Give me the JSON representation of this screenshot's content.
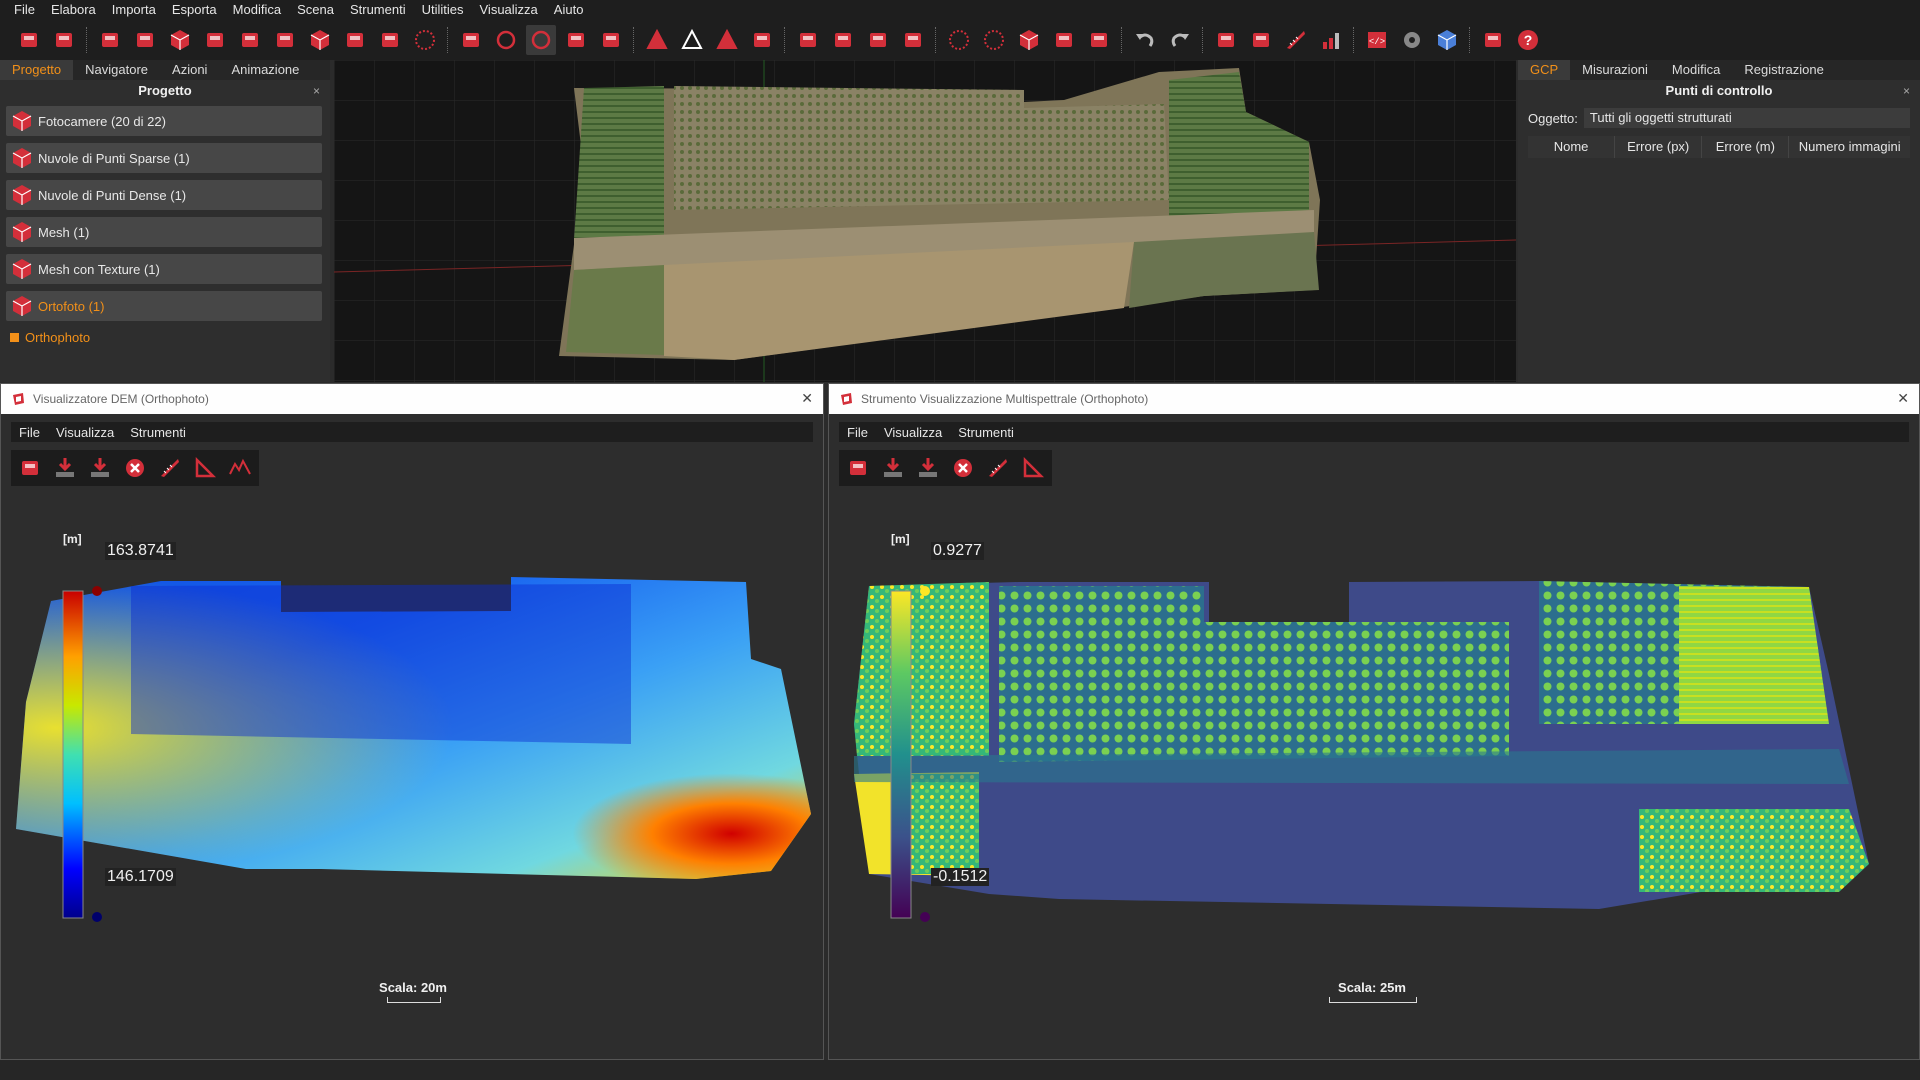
{
  "menu": [
    "File",
    "Elabora",
    "Importa",
    "Esporta",
    "Modifica",
    "Scena",
    "Strumenti",
    "Utilities",
    "Visualizza",
    "Aiuto"
  ],
  "toolbar_icons": [
    "open-folder-icon",
    "save-icon",
    "new-project-icon",
    "add-cameras-icon",
    "cube-icon",
    "import-icon",
    "sparse-cloud-icon",
    "dense-cloud-icon",
    "mesh-icon",
    "texture-icon",
    "photo-icon",
    "sphere-icon",
    "camera-icon",
    "rotate-icon",
    "orbit-icon",
    "dots-icon",
    "point-light-icon",
    "mesh-shade-icon",
    "wireframe-icon",
    "solid-icon",
    "brush-icon",
    "projector-icon",
    "hand-icon",
    "cursor-icon",
    "cloud-icon",
    "sphere-grid-icon",
    "sphere-dots-icon",
    "red-cube-icon",
    "box-grid-icon",
    "export-icon",
    "undo-icon",
    "redo-icon",
    "gizmo-icon",
    "crop-icon",
    "ruler-icon",
    "chart-icon",
    "script-icon",
    "settings-icon",
    "cube-blue-icon",
    "logo-icon",
    "help-icon"
  ],
  "colors": {
    "accent": "#f29019",
    "brand_red": "#d32f3a",
    "panel": "#2e2e2e",
    "bg": "#151515"
  },
  "left_panel": {
    "tabs": [
      "Progetto",
      "Navigatore",
      "Azioni",
      "Animazione"
    ],
    "title": "Progetto",
    "items": [
      {
        "label": "Fotocamere (20 di 22)",
        "icon": "cameras-icon"
      },
      {
        "label": "Nuvole di Punti Sparse (1)",
        "icon": "sparse-cloud-icon"
      },
      {
        "label": "Nuvole di Punti Dense (1)",
        "icon": "dense-cloud-icon"
      },
      {
        "label": "Mesh (1)",
        "icon": "mesh-icon"
      },
      {
        "label": "Mesh con Texture (1)",
        "icon": "textured-mesh-icon"
      },
      {
        "label": "Ortofoto (1)",
        "icon": "orthophoto-icon"
      }
    ],
    "subitem": "Orthophoto"
  },
  "right_panel": {
    "tabs": [
      "GCP",
      "Misurazioni",
      "Modifica",
      "Registrazione"
    ],
    "title": "Punti di controllo",
    "object_label": "Oggetto:",
    "object_value": "Tutti gli oggetti strutturati",
    "columns": [
      "Nome",
      "Errore (px)",
      "Errore (m)",
      "Numero immagini"
    ]
  },
  "dem_window": {
    "title": "Visualizzatore DEM (Orthophoto)",
    "menu": [
      "File",
      "Visualizza",
      "Strumenti"
    ],
    "unit": "[m]",
    "max": "163.8741",
    "min": "146.1709",
    "scale": "Scala: 20m"
  },
  "ms_window": {
    "title": "Strumento Visualizzazione Multispettrale (Orthophoto)",
    "menu": [
      "File",
      "Visualizza",
      "Strumenti"
    ],
    "unit": "[m]",
    "max": "0.9277",
    "min": "-0.1512",
    "scale": "Scala: 25m"
  }
}
